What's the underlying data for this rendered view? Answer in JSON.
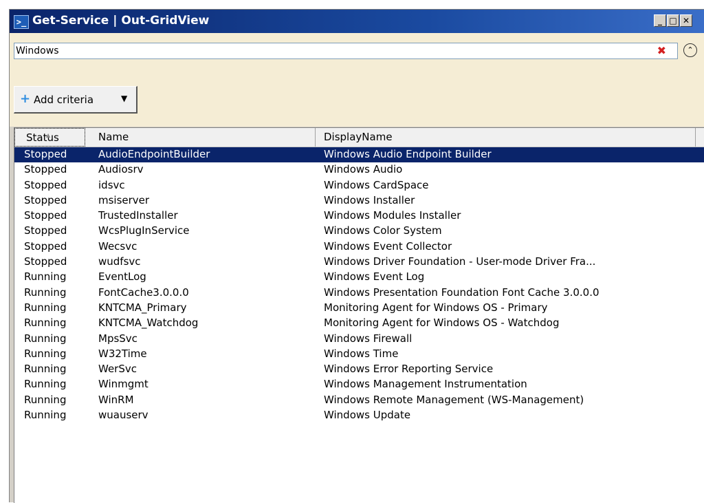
{
  "window": {
    "title": "Get-Service | Out-GridView",
    "icon": "powershell-icon"
  },
  "filter": {
    "value": "Windows",
    "placeholder": ""
  },
  "add_criteria": {
    "label": "Add criteria"
  },
  "columns": [
    "Status",
    "Name",
    "DisplayName"
  ],
  "selected_row": 0,
  "rows": [
    {
      "status": "Stopped",
      "name": "AudioEndpointBuilder",
      "display": "Windows Audio Endpoint Builder"
    },
    {
      "status": "Stopped",
      "name": "Audiosrv",
      "display": "Windows Audio"
    },
    {
      "status": "Stopped",
      "name": "idsvc",
      "display": "Windows CardSpace"
    },
    {
      "status": "Stopped",
      "name": "msiserver",
      "display": "Windows Installer"
    },
    {
      "status": "Stopped",
      "name": "TrustedInstaller",
      "display": "Windows Modules Installer"
    },
    {
      "status": "Stopped",
      "name": "WcsPlugInService",
      "display": "Windows Color System"
    },
    {
      "status": "Stopped",
      "name": "Wecsvc",
      "display": "Windows Event Collector"
    },
    {
      "status": "Stopped",
      "name": "wudfsvc",
      "display": "Windows Driver Foundation - User-mode Driver Fra..."
    },
    {
      "status": "Running",
      "name": "EventLog",
      "display": "Windows Event Log"
    },
    {
      "status": "Running",
      "name": "FontCache3.0.0.0",
      "display": "Windows Presentation Foundation Font Cache 3.0.0.0"
    },
    {
      "status": "Running",
      "name": "KNTCMA_Primary",
      "display": "Monitoring Agent for Windows OS - Primary"
    },
    {
      "status": "Running",
      "name": "KNTCMA_Watchdog",
      "display": "Monitoring Agent for Windows OS - Watchdog"
    },
    {
      "status": "Running",
      "name": "MpsSvc",
      "display": "Windows Firewall"
    },
    {
      "status": "Running",
      "name": "W32Time",
      "display": "Windows Time"
    },
    {
      "status": "Running",
      "name": "WerSvc",
      "display": "Windows Error Reporting Service"
    },
    {
      "status": "Running",
      "name": "Winmgmt",
      "display": "Windows Management Instrumentation"
    },
    {
      "status": "Running",
      "name": "WinRM",
      "display": "Windows Remote Management (WS-Management)"
    },
    {
      "status": "Running",
      "name": "wuauserv",
      "display": "Windows Update"
    }
  ],
  "colors": {
    "titlebar": "#0a246a",
    "filter_bg": "#f5edd5",
    "selection": "#0a246a",
    "clear": "#d42020"
  }
}
